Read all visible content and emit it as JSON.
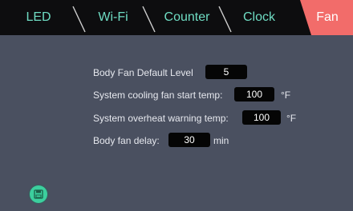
{
  "tabs": [
    {
      "label": "LED"
    },
    {
      "label": "Wi-Fi"
    },
    {
      "label": "Counter"
    },
    {
      "label": "Clock"
    },
    {
      "label": "Fan"
    }
  ],
  "active_tab": "Fan",
  "settings": {
    "default_level": {
      "label": "Body Fan Default Level",
      "value": "5"
    },
    "start_temp": {
      "label": "System cooling fan start temp:",
      "value": "100",
      "unit": "°F"
    },
    "warning_temp": {
      "label": "System overheat warning temp:",
      "value": "100",
      "unit": "°F"
    },
    "delay": {
      "label": "Body fan delay:",
      "value": "30",
      "unit": "min"
    }
  },
  "colors": {
    "background": "#4a5060",
    "tabbar": "#0d0d0f",
    "tab_text": "#6fdcc3",
    "active_tab": "#f26c6a",
    "icon": "#3ccf9e"
  },
  "icons": [
    "save-icon"
  ]
}
